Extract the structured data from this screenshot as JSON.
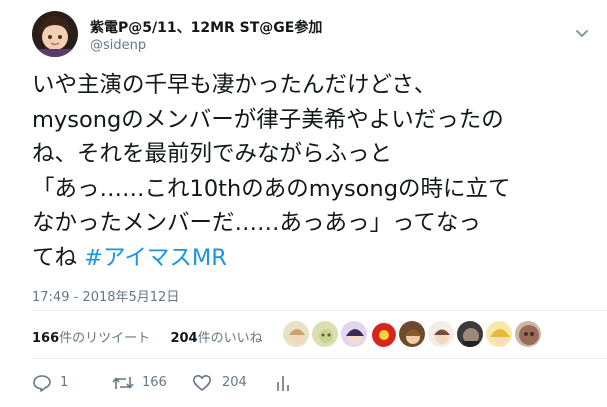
{
  "author": {
    "display_name": "紫電P@5/11、12MR ST@GE参加",
    "handle": "@sidenp"
  },
  "tweet": {
    "lines": [
      "いや主演の千早も凄かったんだけどさ、",
      "mysongのメンバーが律子美希やよいだったの",
      "ね、それを最前列でみながらふっと",
      "「あっ……これ10thのあのmysongの時に立て",
      "なかったメンバーだ……あっあっ」ってなっ"
    ],
    "last_line_prefix": "てね ",
    "hashtag": "#アイマスMR",
    "timestamp": "17:49 - 2018年5月12日"
  },
  "stats": {
    "retweet_count": "166",
    "retweet_label": "件のリツイート",
    "like_count": "204",
    "like_label": "件のいいね"
  },
  "actions": {
    "reply_count": "1",
    "retweet_count": "166",
    "like_count": "204"
  },
  "colors": {
    "link": "#1b95e0",
    "muted": "#657786",
    "text": "#14171a",
    "divider": "#e6ecf0"
  }
}
